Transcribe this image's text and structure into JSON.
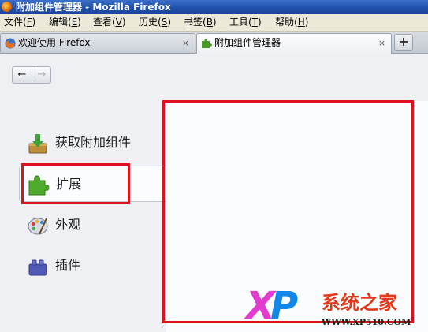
{
  "window": {
    "title": "附加组件管理器 - Mozilla Firefox"
  },
  "menubar": {
    "items": [
      {
        "label": "文件(",
        "key": "F",
        "tail": ")"
      },
      {
        "label": "编辑(",
        "key": "E",
        "tail": ")"
      },
      {
        "label": "查看(",
        "key": "V",
        "tail": ")"
      },
      {
        "label": "历史(",
        "key": "S",
        "tail": ")"
      },
      {
        "label": "书签(",
        "key": "B",
        "tail": ")"
      },
      {
        "label": "工具(",
        "key": "T",
        "tail": ")"
      },
      {
        "label": "帮助(",
        "key": "H",
        "tail": ")"
      }
    ]
  },
  "tabs": [
    {
      "label": "欢迎使用 Firefox",
      "close": "×",
      "icon": "firefox-icon",
      "active": false
    },
    {
      "label": "附加组件管理器",
      "close": "×",
      "icon": "puzzle-icon",
      "active": true
    }
  ],
  "newtab": {
    "label": "+"
  },
  "nav": {
    "back": "←",
    "forward": "→"
  },
  "sidebar": {
    "categories": [
      {
        "label": "获取附加组件",
        "icon": "download-box-icon",
        "selected": false
      },
      {
        "label": "扩展",
        "icon": "puzzle-piece-icon",
        "selected": true
      },
      {
        "label": "外观",
        "icon": "palette-icon",
        "selected": false
      },
      {
        "label": "插件",
        "icon": "plugin-brick-icon",
        "selected": false
      }
    ]
  },
  "watermark": {
    "logo_x": "X",
    "logo_p": "P",
    "name": "系统之家",
    "url": "WWW.XP510.COM"
  },
  "colors": {
    "highlight": "#e0111f",
    "titlebar": "#1f4fa8",
    "menubar": "#ece9d8"
  }
}
